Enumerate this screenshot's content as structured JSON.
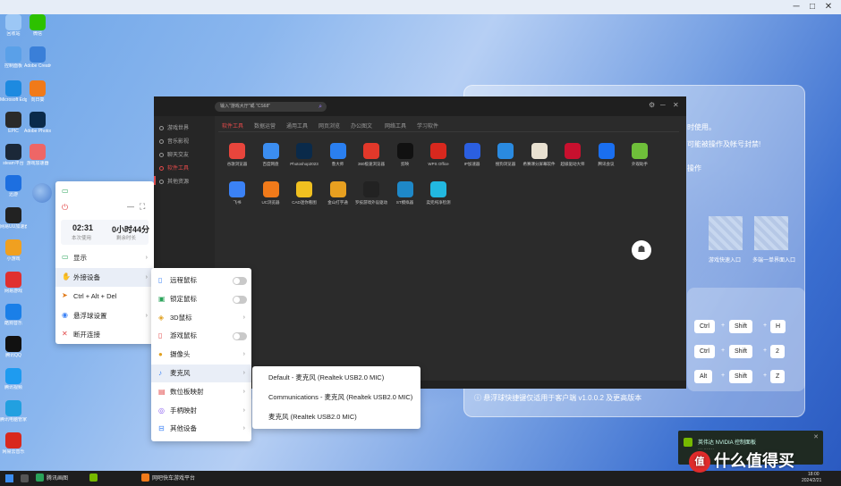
{
  "desktop_icons": [
    {
      "label": "回收站",
      "color": "#9cc7f5"
    },
    {
      "label": "微信",
      "color": "#2dc100"
    },
    {
      "label": "控制面板",
      "color": "#5aa0e8"
    },
    {
      "label": "Adobe Creative Cloud",
      "color": "#3a7fd8"
    },
    {
      "label": "Microsoft Edge",
      "color": "#1d8ae0"
    },
    {
      "label": "向日葵",
      "color": "#f07a1a"
    },
    {
      "label": "EPIC",
      "color": "#2a2a2a"
    },
    {
      "label": "Adobe Photoshop",
      "color": "#0a2a4a"
    },
    {
      "label": "steam平台",
      "color": "#1b2838"
    },
    {
      "label": "游戏加速器",
      "color": "#e66"
    },
    {
      "label": "迅游",
      "color": "#1d6fe0"
    },
    {
      "label": "网易UU加速器",
      "color": "#222"
    },
    {
      "label": "小游戏",
      "color": "#f0a020"
    },
    {
      "label": "网易游戏",
      "color": "#e03030"
    },
    {
      "label": "酷狗音乐",
      "color": "#1a7fe8"
    },
    {
      "label": "腾讯QQ",
      "color": "#111"
    },
    {
      "label": "腾讯视频",
      "color": "#1e9bf0"
    },
    {
      "label": "腾讯电脑管家",
      "color": "#22a0e0"
    },
    {
      "label": "网易云音乐",
      "color": "#d8281e"
    }
  ],
  "bg_client": {
    "line1": "时使用。",
    "line2": "可能被操作及帐号封禁!",
    "line3": "操作",
    "label_a": "游戏快速入口",
    "label_b": "多端一单界面入口",
    "hotkeys": [
      [
        "Ctrl",
        "Shift",
        "H"
      ],
      [
        "Ctrl",
        "Shift",
        "2"
      ],
      [
        "Alt",
        "Shift",
        "Z"
      ]
    ],
    "note": "悬浮球快捷键仅适用于客户端 v1.0.0.2 及更高版本"
  },
  "app": {
    "search_placeholder": "输入\"游戏大厅\"或 \"CS68\"",
    "sidebar": [
      {
        "label": "游戏世界",
        "active": false
      },
      {
        "label": "音乐影视",
        "active": false
      },
      {
        "label": "聊天交友",
        "active": false
      },
      {
        "label": "软件工具",
        "active": true
      },
      {
        "label": "其他资源",
        "active": false
      }
    ],
    "tabs": [
      {
        "label": "软件工具",
        "active": true
      },
      {
        "label": "数据运营",
        "active": false
      },
      {
        "label": "通用工具",
        "active": false
      },
      {
        "label": "网页浏览",
        "active": false
      },
      {
        "label": "办公图文",
        "active": false
      },
      {
        "label": "网络工具",
        "active": false
      },
      {
        "label": "学习软件",
        "active": false
      }
    ],
    "apps_row1": [
      {
        "label": "谷歌浏览器",
        "color": "#e8453c"
      },
      {
        "label": "百度网盘",
        "color": "#3b8df0"
      },
      {
        "label": "Photoshop2023",
        "color": "#0a2a4a"
      },
      {
        "label": "鲁大师",
        "color": "#2a7ff0"
      },
      {
        "label": "360极速浏览器",
        "color": "#e2382a"
      },
      {
        "label": "剪映",
        "color": "#111"
      },
      {
        "label": "WPS Office",
        "color": "#d8281e"
      },
      {
        "label": "IP加速器",
        "color": "#2b5fe0"
      },
      {
        "label": "搜狗浏览器",
        "color": "#2a8ae0"
      },
      {
        "label": "希赛课分屏幕软件",
        "color": "#e9e1d1"
      },
      {
        "label": "超级驱动大师",
        "color": "#c8102e"
      },
      {
        "label": "腾讯会议",
        "color": "#1a6ff0"
      },
      {
        "label": "外观助手",
        "color": "#6fbf3a"
      }
    ],
    "apps_row2": [
      {
        "label": "飞书",
        "color": "#3b82f6"
      },
      {
        "label": "UC浏览器",
        "color": "#f07a1a"
      },
      {
        "label": "CAD迷你看图",
        "color": "#f0c020"
      },
      {
        "label": "金山打字通",
        "color": "#e8a020"
      },
      {
        "label": "罗技游戏外设驱动",
        "color": "#222"
      },
      {
        "label": "ST模拟器",
        "color": "#1e88c8"
      },
      {
        "label": "奕兜纯净检测",
        "color": "#22b8e0"
      }
    ]
  },
  "float_panel": {
    "time_value": "02:31",
    "time_label": "本次使用",
    "remain_value": "0小时44分",
    "remain_label": "剩余时长",
    "items": [
      {
        "label": "显示",
        "icon": "▭",
        "color": "#2aa35a",
        "arrow": true,
        "hl": false
      },
      {
        "label": "外接设备",
        "icon": "✋",
        "color": "#3b82f6",
        "arrow": true,
        "hl": true
      },
      {
        "label": "Ctrl + Alt + Del",
        "icon": "➤",
        "color": "#e07a1a",
        "arrow": false,
        "hl": false
      },
      {
        "label": "悬浮球设置",
        "icon": "◉",
        "color": "#3b82f6",
        "arrow": true,
        "hl": false
      },
      {
        "label": "断开连接",
        "icon": "✕",
        "color": "#e24a4a",
        "arrow": false,
        "hl": false
      }
    ]
  },
  "submenu": [
    {
      "label": "远程鼠标",
      "kind": "toggle",
      "icon": "▯",
      "color": "#3b82f6"
    },
    {
      "label": "锁定鼠标",
      "kind": "toggle",
      "icon": "▣",
      "color": "#2aa35a"
    },
    {
      "label": "3D鼠标",
      "kind": "arrow",
      "icon": "◈",
      "color": "#e0a020"
    },
    {
      "label": "游戏鼠标",
      "kind": "toggle",
      "icon": "▯",
      "color": "#e24a4a"
    },
    {
      "label": "摄像头",
      "kind": "arrow",
      "icon": "●",
      "color": "#e0a020"
    },
    {
      "label": "麦克风",
      "kind": "arrow",
      "icon": "♪",
      "color": "#3b82f6"
    },
    {
      "label": "数位板映射",
      "kind": "arrow",
      "icon": "▤",
      "color": "#e24a4a"
    },
    {
      "label": "手柄映射",
      "kind": "arrow",
      "icon": "◎",
      "color": "#8a5cf0"
    },
    {
      "label": "其他设备",
      "kind": "arrow",
      "icon": "⊟",
      "color": "#3b82f6"
    }
  ],
  "mic_options": [
    "Default - 麦克风 (Realtek USB2.0 MIC)",
    "Communications - 麦克风 (Realtek USB2.0 MIC)",
    "麦克风 (Realtek USB2.0 MIC)"
  ],
  "toast": {
    "title": "英伟达 NVIDIA 控制面板",
    "sub": "··· ·······"
  },
  "taskbar": {
    "items": [
      {
        "label": "腾讯画图",
        "color": "#2aa35a"
      },
      {
        "label": "",
        "color": "#76b900"
      },
      {
        "label": "网吧快车游戏平台",
        "color": "#f07a1a"
      }
    ],
    "clock": "18:00",
    "date": "2024/2/21"
  },
  "watermark": "什么值得买",
  "watermark_badge": "值"
}
